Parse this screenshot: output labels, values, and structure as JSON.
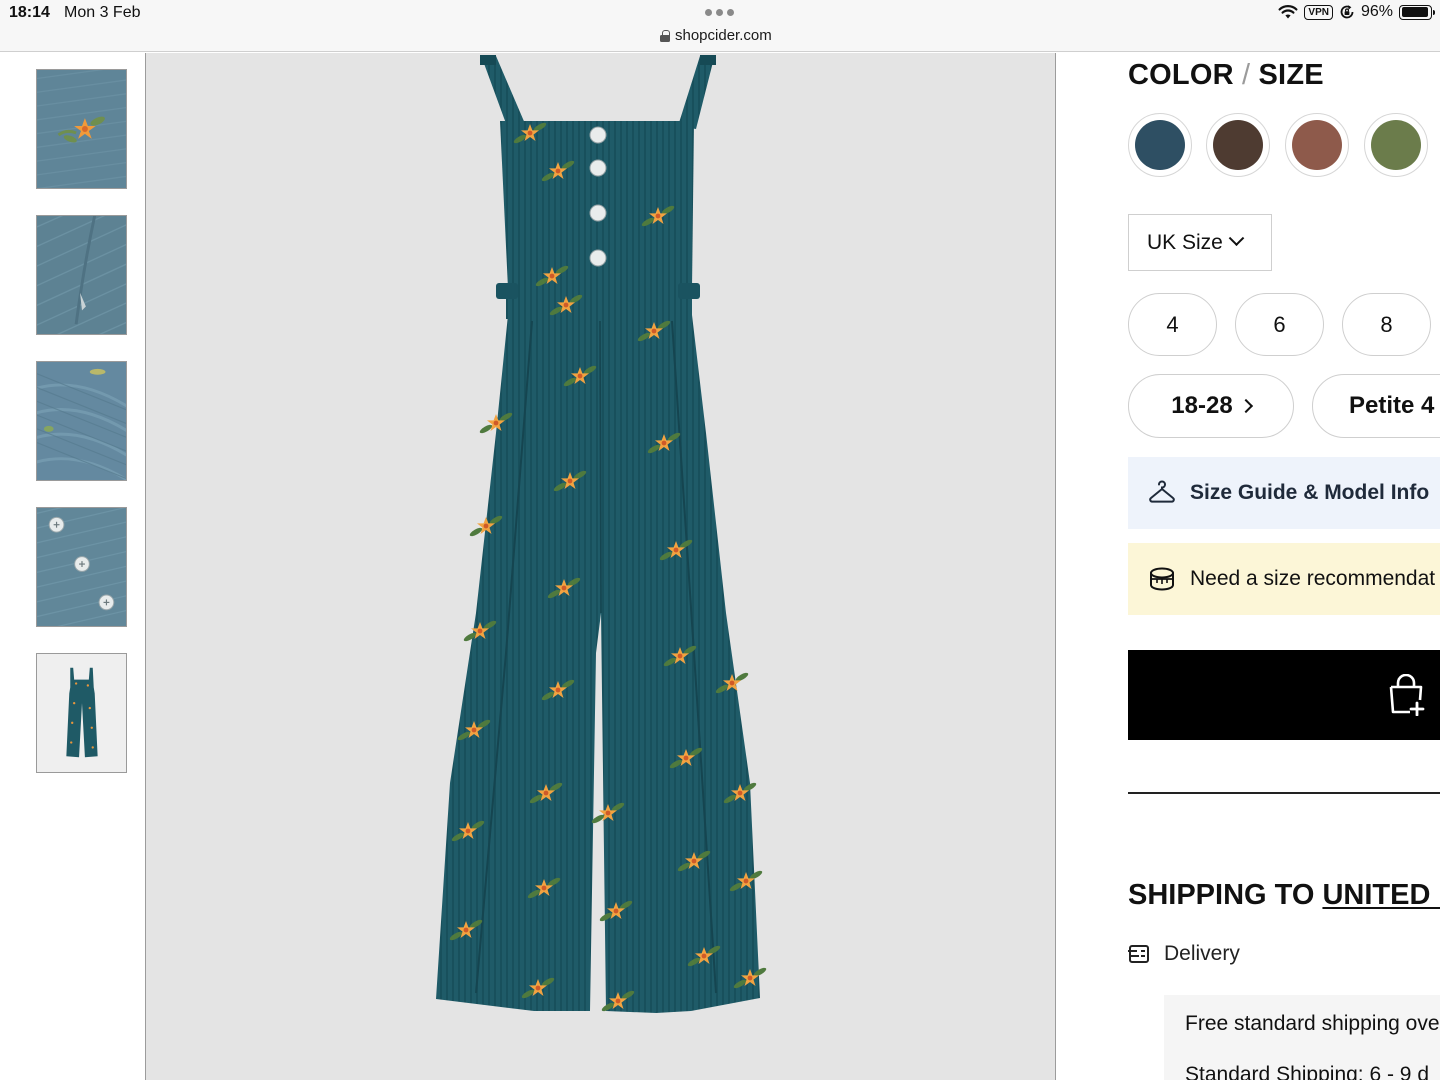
{
  "status_bar": {
    "time": "18:14",
    "date": "Mon 3 Feb",
    "url": "shopcider.com",
    "vpn": "VPN",
    "battery": "96%",
    "battery_level": 0.96
  },
  "thumbnails": [
    {
      "name": "flower-closeup"
    },
    {
      "name": "pocket-closeup"
    },
    {
      "name": "fabric-closeup"
    },
    {
      "name": "buttons-closeup"
    },
    {
      "name": "full-product",
      "active": true
    }
  ],
  "product": {
    "main_image": "corduroy-floral-overall-jumpsuit"
  },
  "options": {
    "title_color": "COLOR",
    "title_sep": "/",
    "title_size": "SIZE",
    "colors": [
      {
        "hex": "#2e4f63"
      },
      {
        "hex": "#4e3b31"
      },
      {
        "hex": "#8e5a4b"
      },
      {
        "hex": "#6b7c4b"
      }
    ],
    "size_system": "UK Size",
    "sizes": [
      "4",
      "6",
      "8"
    ],
    "size_range": "18-28",
    "petite": "Petite 4"
  },
  "size_guide": {
    "label": "Size Guide & Model Info",
    "icon": "hanger-icon"
  },
  "recommendation": {
    "label": "Need a size recommendat",
    "icon": "measuring-tape-icon"
  },
  "add_to_bag": {
    "icon": "bag-plus-icon"
  },
  "shipping": {
    "title_prefix": "SHIPPING TO ",
    "country": "UNITED I",
    "delivery_label": "Delivery",
    "lines": [
      "Free standard shipping ove",
      "Standard Shipping: 6 - 9 d"
    ]
  },
  "colors": {
    "accent_black": "#000000",
    "guide_bg": "#eef3fb",
    "reco_bg": "#fcf6d7",
    "fabric_teal": "#1f5a66"
  }
}
